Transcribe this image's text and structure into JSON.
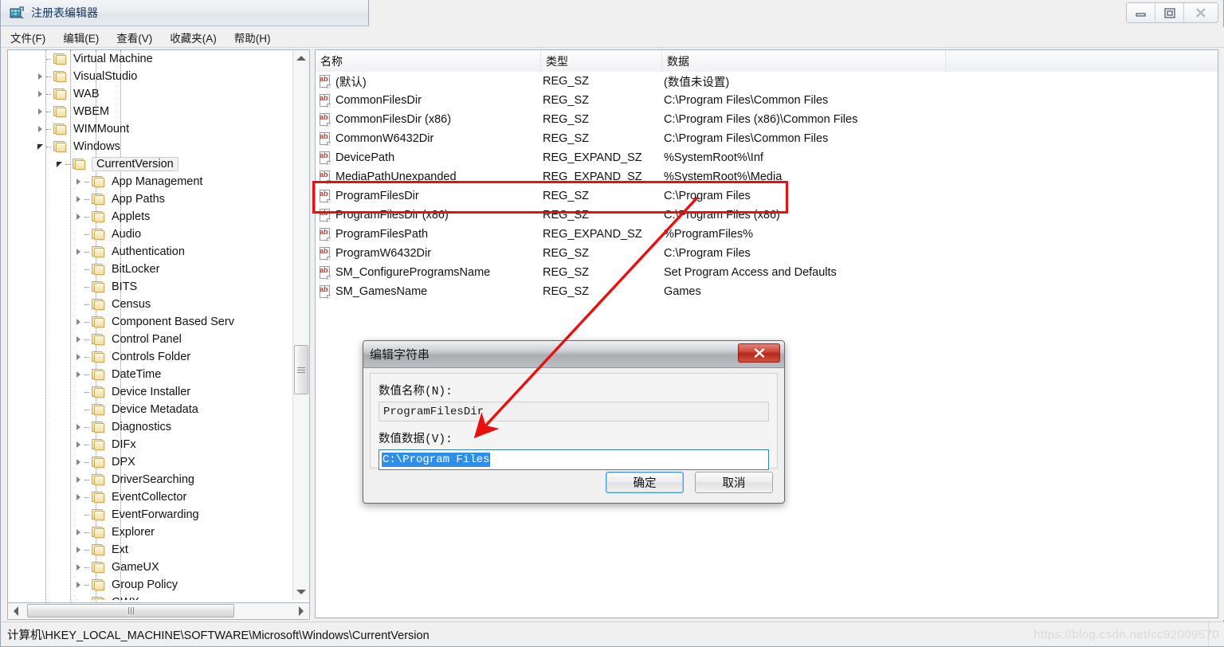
{
  "window": {
    "title": "注册表编辑器",
    "app_icon": "registry-editor-icon",
    "buttons": {
      "minimize": "minimize-icon",
      "restore": "restore-icon",
      "close": "close-icon"
    }
  },
  "menubar": {
    "items": [
      {
        "label": "文件(F)"
      },
      {
        "label": "编辑(E)"
      },
      {
        "label": "查看(V)"
      },
      {
        "label": "收藏夹(A)"
      },
      {
        "label": "帮助(H)"
      }
    ]
  },
  "tree": {
    "nodes": [
      {
        "label": "Virtual Machine",
        "indent": 3,
        "state": "leaf",
        "selected": false
      },
      {
        "label": "VisualStudio",
        "indent": 3,
        "state": "collapsed",
        "selected": false
      },
      {
        "label": "WAB",
        "indent": 3,
        "state": "collapsed",
        "selected": false
      },
      {
        "label": "WBEM",
        "indent": 3,
        "state": "collapsed",
        "selected": false
      },
      {
        "label": "WIMMount",
        "indent": 3,
        "state": "collapsed",
        "selected": false
      },
      {
        "label": "Windows",
        "indent": 3,
        "state": "expanded",
        "selected": false
      },
      {
        "label": "CurrentVersion",
        "indent": 4,
        "state": "expanded",
        "selected": true
      },
      {
        "label": "App Management",
        "indent": 5,
        "state": "collapsed",
        "selected": false
      },
      {
        "label": "App Paths",
        "indent": 5,
        "state": "collapsed",
        "selected": false
      },
      {
        "label": "Applets",
        "indent": 5,
        "state": "collapsed",
        "selected": false
      },
      {
        "label": "Audio",
        "indent": 5,
        "state": "leaf",
        "selected": false
      },
      {
        "label": "Authentication",
        "indent": 5,
        "state": "collapsed",
        "selected": false
      },
      {
        "label": "BitLocker",
        "indent": 5,
        "state": "leaf",
        "selected": false
      },
      {
        "label": "BITS",
        "indent": 5,
        "state": "leaf",
        "selected": false
      },
      {
        "label": "Census",
        "indent": 5,
        "state": "leaf",
        "selected": false
      },
      {
        "label": "Component Based Serv",
        "indent": 5,
        "state": "collapsed",
        "selected": false
      },
      {
        "label": "Control Panel",
        "indent": 5,
        "state": "collapsed",
        "selected": false
      },
      {
        "label": "Controls Folder",
        "indent": 5,
        "state": "collapsed",
        "selected": false
      },
      {
        "label": "DateTime",
        "indent": 5,
        "state": "collapsed",
        "selected": false
      },
      {
        "label": "Device Installer",
        "indent": 5,
        "state": "leaf",
        "selected": false
      },
      {
        "label": "Device Metadata",
        "indent": 5,
        "state": "leaf",
        "selected": false
      },
      {
        "label": "Diagnostics",
        "indent": 5,
        "state": "collapsed",
        "selected": false
      },
      {
        "label": "DIFx",
        "indent": 5,
        "state": "collapsed",
        "selected": false
      },
      {
        "label": "DPX",
        "indent": 5,
        "state": "collapsed",
        "selected": false
      },
      {
        "label": "DriverSearching",
        "indent": 5,
        "state": "collapsed",
        "selected": false
      },
      {
        "label": "EventCollector",
        "indent": 5,
        "state": "collapsed",
        "selected": false
      },
      {
        "label": "EventForwarding",
        "indent": 5,
        "state": "leaf",
        "selected": false
      },
      {
        "label": "Explorer",
        "indent": 5,
        "state": "collapsed",
        "selected": false
      },
      {
        "label": "Ext",
        "indent": 5,
        "state": "collapsed",
        "selected": false
      },
      {
        "label": "GameUX",
        "indent": 5,
        "state": "collapsed",
        "selected": false
      },
      {
        "label": "Group Policy",
        "indent": 5,
        "state": "collapsed",
        "selected": false
      },
      {
        "label": "GWX",
        "indent": 5,
        "state": "collapsed",
        "selected": false
      }
    ]
  },
  "list": {
    "columns": [
      {
        "label": "名称"
      },
      {
        "label": "类型"
      },
      {
        "label": "数据"
      },
      {
        "label": ""
      }
    ],
    "rows": [
      {
        "name": "(默认)",
        "type": "REG_SZ",
        "data": "(数值未设置)"
      },
      {
        "name": "CommonFilesDir",
        "type": "REG_SZ",
        "data": "C:\\Program Files\\Common Files"
      },
      {
        "name": "CommonFilesDir (x86)",
        "type": "REG_SZ",
        "data": "C:\\Program Files (x86)\\Common Files"
      },
      {
        "name": "CommonW6432Dir",
        "type": "REG_SZ",
        "data": "C:\\Program Files\\Common Files"
      },
      {
        "name": "DevicePath",
        "type": "REG_EXPAND_SZ",
        "data": "%SystemRoot%\\Inf"
      },
      {
        "name": "MediaPathUnexpanded",
        "type": "REG_EXPAND_SZ",
        "data": "%SystemRoot%\\Media"
      },
      {
        "name": "ProgramFilesDir",
        "type": "REG_SZ",
        "data": "C:\\Program Files"
      },
      {
        "name": "ProgramFilesDir (x86)",
        "type": "REG_SZ",
        "data": "C:\\Program Files (x86)"
      },
      {
        "name": "ProgramFilesPath",
        "type": "REG_EXPAND_SZ",
        "data": "%ProgramFiles%"
      },
      {
        "name": "ProgramW6432Dir",
        "type": "REG_SZ",
        "data": "C:\\Program Files"
      },
      {
        "name": "SM_ConfigureProgramsName",
        "type": "REG_SZ",
        "data": "Set Program Access and Defaults"
      },
      {
        "name": "SM_GamesName",
        "type": "REG_SZ",
        "data": "Games"
      }
    ]
  },
  "dialog": {
    "title": "编辑字符串",
    "close_icon": "close-icon",
    "name_label": "数值名称(N):",
    "name_value": "ProgramFilesDir",
    "data_label": "数值数据(V):",
    "data_value": "C:\\Program Files",
    "ok_label": "确定",
    "cancel_label": "取消"
  },
  "statusbar": {
    "path": "计算机\\HKEY_LOCAL_MACHINE\\SOFTWARE\\Microsoft\\Windows\\CurrentVersion",
    "watermark": "https://blog.csdn.net/cc92009570"
  },
  "annotation": {
    "rect_color": "#e8110f",
    "arrow_color": "#e8110f"
  }
}
